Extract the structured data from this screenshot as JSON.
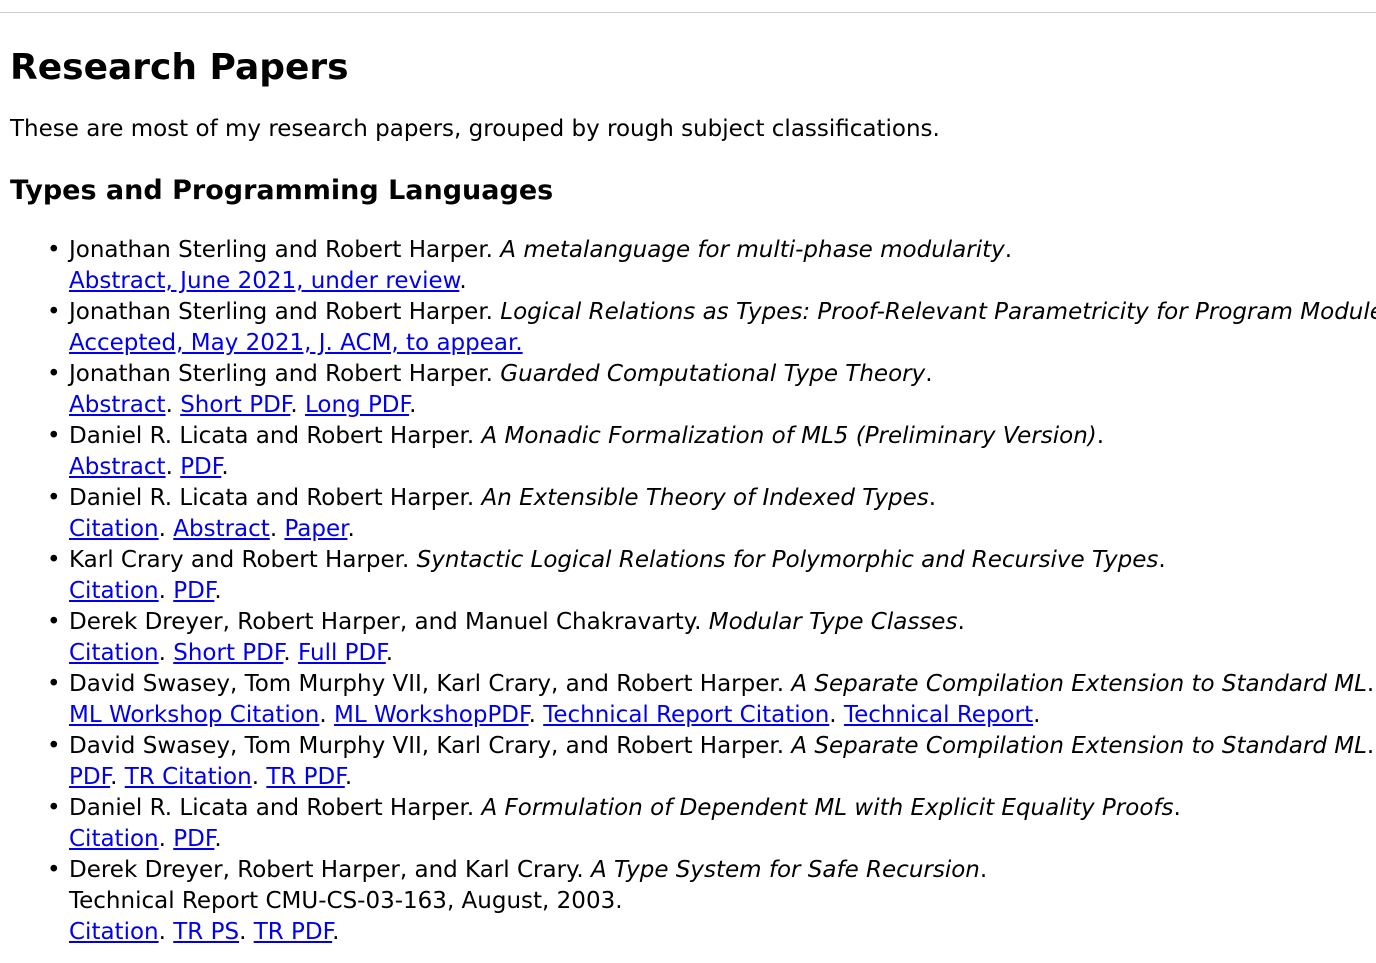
{
  "page": {
    "title": "Research Papers",
    "intro": "These are most of my research papers, grouped by rough subject classifications."
  },
  "section": {
    "heading": "Types and Programming Languages"
  },
  "papers": [
    {
      "authors": "Jonathan Sterling and Robert Harper.",
      "title": "A metalanguage for multi-phase modularity",
      "links": [
        "Abstract, June 2021, under review"
      ]
    },
    {
      "authors": "Jonathan Sterling and Robert Harper.",
      "title": "Logical Relations as Types: Proof-Relevant Parametricity for Program Modules",
      "links": [
        "Accepted, May 2021, J. ACM, to appear."
      ]
    },
    {
      "authors": "Jonathan Sterling and Robert Harper.",
      "title": "Guarded Computational Type Theory",
      "links": [
        "Abstract",
        "Short PDF",
        "Long PDF"
      ]
    },
    {
      "authors": "Daniel R. Licata and Robert Harper.",
      "title": "A Monadic Formalization of ML5 (Preliminary Version)",
      "links": [
        "Abstract",
        "PDF"
      ]
    },
    {
      "authors": "Daniel R. Licata and Robert Harper.",
      "title": "An Extensible Theory of Indexed Types",
      "links": [
        "Citation",
        "Abstract",
        "Paper"
      ]
    },
    {
      "authors": "Karl Crary and Robert Harper.",
      "title": "Syntactic Logical Relations for Polymorphic and Recursive Types",
      "links": [
        "Citation",
        "PDF"
      ]
    },
    {
      "authors": "Derek Dreyer, Robert Harper, and Manuel Chakravarty.",
      "title": "Modular Type Classes",
      "links": [
        "Citation",
        "Short PDF",
        "Full PDF"
      ]
    },
    {
      "authors": "David Swasey, Tom Murphy VII, Karl Crary, and Robert Harper.",
      "title": "A Separate Compilation Extension to Standard ML",
      "links": [
        "ML Workshop Citation",
        "ML WorkshopPDF",
        "Technical Report Citation",
        "Technical Report"
      ]
    },
    {
      "authors": "David Swasey, Tom Murphy VII, Karl Crary, and Robert Harper.",
      "title": "A Separate Compilation Extension to Standard ML",
      "links": [
        "PDF",
        "TR Citation",
        "TR PDF"
      ]
    },
    {
      "authors": "Daniel R. Licata and Robert Harper.",
      "title": "A Formulation of Dependent ML with Explicit Equality Proofs",
      "links": [
        "Citation",
        "PDF"
      ]
    },
    {
      "authors": "Derek Dreyer, Robert Harper, and Karl Crary.",
      "title": "A Type System for Safe Recursion",
      "note": "Technical Report CMU-CS-03-163, August, 2003.",
      "links": [
        "Citation",
        "TR PS",
        "TR PDF"
      ]
    }
  ],
  "colors": {
    "link": "#0000ee",
    "text": "#000000",
    "background": "#ffffff"
  }
}
